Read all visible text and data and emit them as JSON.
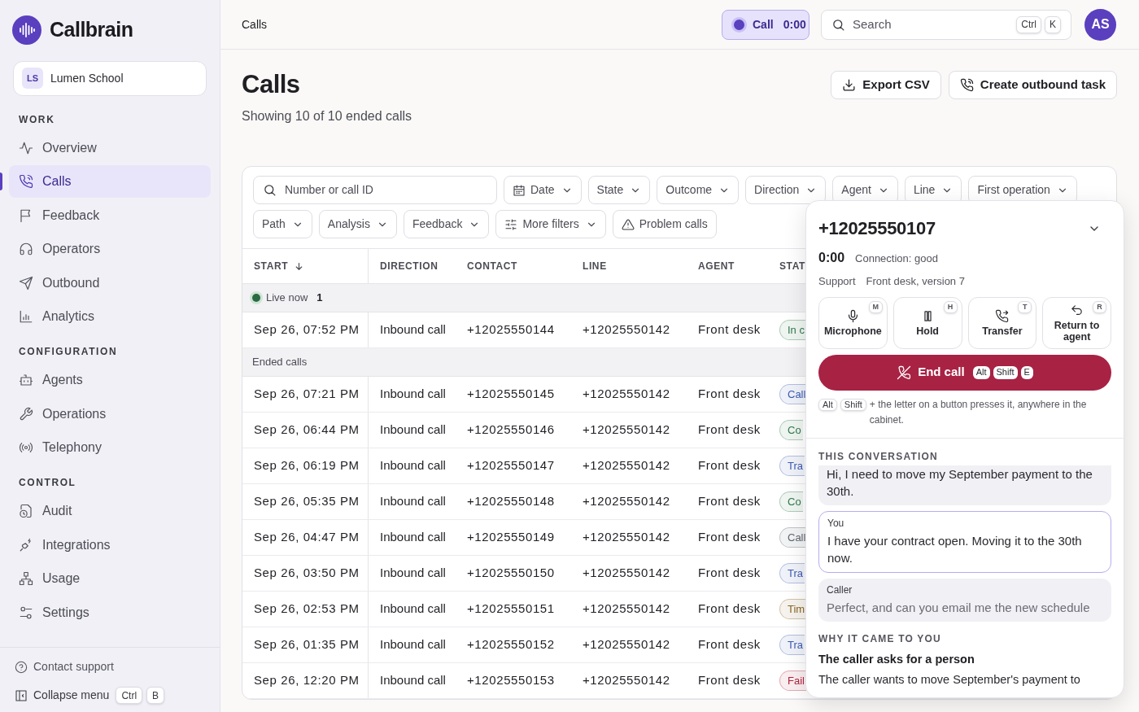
{
  "brand": {
    "name": "Callbrain"
  },
  "workspace": {
    "initials": "LS",
    "name": "Lumen School"
  },
  "nav": [
    {
      "heading": "WORK",
      "items": [
        {
          "label": "Overview",
          "selected": false
        },
        {
          "label": "Calls",
          "selected": true
        },
        {
          "label": "Feedback",
          "selected": false
        },
        {
          "label": "Operators",
          "selected": false
        },
        {
          "label": "Outbound",
          "selected": false
        },
        {
          "label": "Analytics",
          "selected": false
        }
      ]
    },
    {
      "heading": "CONFIGURATION",
      "items": [
        {
          "label": "Agents",
          "selected": false
        },
        {
          "label": "Operations",
          "selected": false
        },
        {
          "label": "Telephony",
          "selected": false
        }
      ]
    },
    {
      "heading": "CONTROL",
      "items": [
        {
          "label": "Audit",
          "selected": false
        },
        {
          "label": "Integrations",
          "selected": false
        },
        {
          "label": "Usage",
          "selected": false
        },
        {
          "label": "Settings",
          "selected": false
        }
      ]
    }
  ],
  "sidebar_footer": {
    "support": "Contact support",
    "collapse": "Collapse menu",
    "keys": [
      "Ctrl",
      "B"
    ]
  },
  "topbar": {
    "breadcrumb": "Calls",
    "call_pill": {
      "label": "Call",
      "timer": "0:00"
    },
    "search": {
      "placeholder": "Search",
      "keys": [
        "Ctrl",
        "K"
      ]
    },
    "avatar": "AS"
  },
  "page": {
    "title": "Calls",
    "subtitle": "Showing 10 of 10 ended calls",
    "actions": [
      "Export CSV",
      "Create outbound task"
    ]
  },
  "filters": {
    "search_placeholder": "Number or call ID",
    "items": [
      {
        "label": "Date",
        "kind": "calendar"
      },
      {
        "label": "State",
        "kind": "dropdown"
      },
      {
        "label": "Outcome",
        "kind": "dropdown"
      },
      {
        "label": "Direction",
        "kind": "dropdown"
      },
      {
        "label": "Agent",
        "kind": "dropdown"
      },
      {
        "label": "Line",
        "kind": "dropdown"
      },
      {
        "label": "First operation",
        "kind": "dropdown"
      },
      {
        "label": "Path",
        "kind": "dropdown"
      },
      {
        "label": "Analysis",
        "kind": "dropdown"
      },
      {
        "label": "Feedback",
        "kind": "dropdown"
      },
      {
        "label": "More filters",
        "kind": "options"
      },
      {
        "label": "Problem calls",
        "kind": "toggle"
      }
    ]
  },
  "table": {
    "columns": [
      {
        "label": "START",
        "sorted": true
      },
      {
        "label": "DIRECTION",
        "sorted": false
      },
      {
        "label": "CONTACT",
        "sorted": false
      },
      {
        "label": "LINE",
        "sorted": false
      },
      {
        "label": "AGENT",
        "sorted": false
      },
      {
        "label": "STAT",
        "sorted": false
      }
    ],
    "groups": [
      {
        "kind": "live",
        "label": "Live now",
        "count": "1",
        "rows": [
          {
            "start": "Sep 26, 07:52 PM",
            "direction": "Inbound call",
            "contact": "+12025550144",
            "line": "+12025550142",
            "agent": "Front desk",
            "status": {
              "text": "In c",
              "color": "#2f7a4b"
            }
          }
        ]
      },
      {
        "kind": "ended",
        "label": "Ended calls",
        "rows": [
          {
            "start": "Sep 26, 07:21 PM",
            "direction": "Inbound call",
            "contact": "+12025550145",
            "line": "+12025550142",
            "agent": "Front desk",
            "status": {
              "text": "Call",
              "color": "#3b5bb5"
            }
          },
          {
            "start": "Sep 26, 06:44 PM",
            "direction": "Inbound call",
            "contact": "+12025550146",
            "line": "+12025550142",
            "agent": "Front desk",
            "status": {
              "text": "Co",
              "color": "#2f7a4b"
            }
          },
          {
            "start": "Sep 26, 06:19 PM",
            "direction": "Inbound call",
            "contact": "+12025550147",
            "line": "+12025550142",
            "agent": "Front desk",
            "status": {
              "text": "Tra",
              "color": "#3b5bb5"
            }
          },
          {
            "start": "Sep 26, 05:35 PM",
            "direction": "Inbound call",
            "contact": "+12025550148",
            "line": "+12025550142",
            "agent": "Front desk",
            "status": {
              "text": "Co",
              "color": "#2f7a4b"
            }
          },
          {
            "start": "Sep 26, 04:47 PM",
            "direction": "Inbound call",
            "contact": "+12025550149",
            "line": "+12025550142",
            "agent": "Front desk",
            "status": {
              "text": "Call",
              "color": "#5f6470"
            }
          },
          {
            "start": "Sep 26, 03:50 PM",
            "direction": "Inbound call",
            "contact": "+12025550150",
            "line": "+12025550142",
            "agent": "Front desk",
            "status": {
              "text": "Tra",
              "color": "#3b5bb5"
            }
          },
          {
            "start": "Sep 26, 02:53 PM",
            "direction": "Inbound call",
            "contact": "+12025550151",
            "line": "+12025550142",
            "agent": "Front desk",
            "status": {
              "text": "Tim",
              "color": "#8a6420"
            }
          },
          {
            "start": "Sep 26, 01:35 PM",
            "direction": "Inbound call",
            "contact": "+12025550152",
            "line": "+12025550142",
            "agent": "Front desk",
            "status": {
              "text": "Tra",
              "color": "#3b5bb5"
            }
          },
          {
            "start": "Sep 26, 12:20 PM",
            "direction": "Inbound call",
            "contact": "+12025550153",
            "line": "+12025550142",
            "agent": "Front desk",
            "status": {
              "text": "Fail",
              "color": "#b4233f"
            }
          }
        ]
      }
    ]
  },
  "call_panel": {
    "number": "+12025550107",
    "timer": "0:00",
    "connection": "Connection: good",
    "queue": "Support",
    "agent": "Front desk, version 7",
    "controls": [
      {
        "label": "Microphone",
        "key": "M"
      },
      {
        "label": "Hold",
        "key": "H"
      },
      {
        "label": "Transfer",
        "key": "T"
      },
      {
        "label": "Return to agent",
        "key": "R"
      }
    ],
    "end_call": {
      "label": "End call",
      "keys": [
        "Alt",
        "Shift",
        "E"
      ]
    },
    "hint": {
      "keys": [
        "Alt",
        "Shift"
      ],
      "text": "+ the letter on a button presses it, anywhere in the cabinet."
    },
    "conversation": {
      "heading": "THIS CONVERSATION",
      "messages": [
        {
          "kind": "caller",
          "text": "Hi, I need to move my September payment to the 30th.",
          "interim": false
        },
        {
          "kind": "you",
          "speaker": "You",
          "text": "I have your contract open. Moving it to the 30th now.",
          "interim": false
        },
        {
          "kind": "caller",
          "speaker": "Caller",
          "text": "Perfect, and can you email me the new schedule",
          "interim": true
        }
      ]
    },
    "reason": {
      "heading": "WHY IT CAME TO YOU",
      "title": "The caller asks for a person",
      "text": "The caller wants to move September's payment to"
    }
  }
}
